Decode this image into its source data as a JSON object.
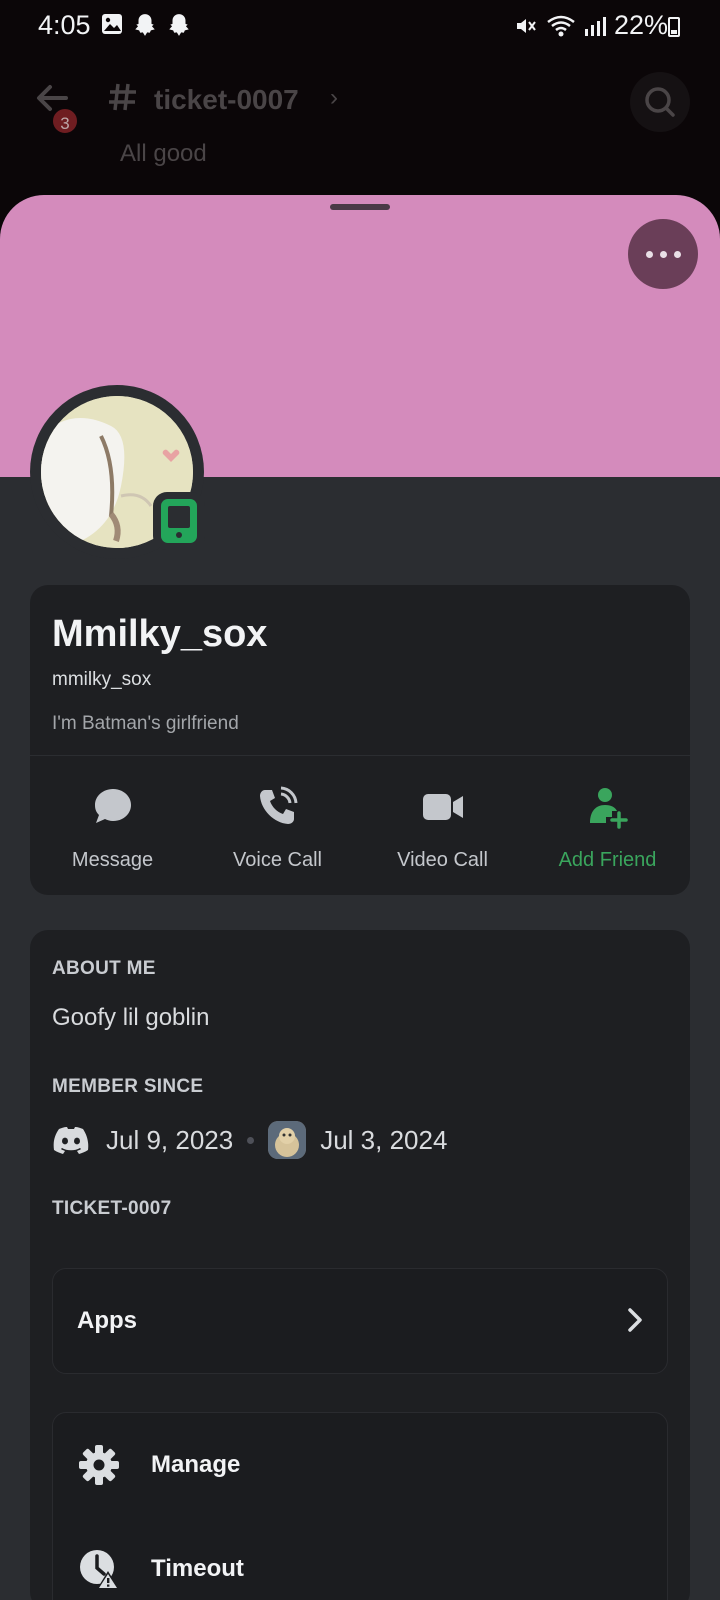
{
  "status_bar": {
    "time": "4:05",
    "battery": "22%",
    "left_icons": [
      "gallery-icon",
      "snapchat-icon",
      "snapchat-icon"
    ],
    "right_icons": [
      "mute-icon",
      "wifi-icon",
      "signal-icon",
      "battery-icon"
    ]
  },
  "channel_header": {
    "title": "ticket-0007",
    "unread_badge": "3",
    "peek_message": "All good"
  },
  "profile": {
    "banner_color": "#d48bbc",
    "display_name": "Mmilky_sox",
    "username": "mmilky_sox",
    "pronouns": "I'm Batman's girlfriend",
    "status": "mobile-online",
    "status_color": "#23a55a",
    "actions": [
      {
        "label": "Message",
        "icon": "message-icon"
      },
      {
        "label": "Voice Call",
        "icon": "voice-call-icon"
      },
      {
        "label": "Video Call",
        "icon": "video-call-icon"
      },
      {
        "label": "Add Friend",
        "icon": "add-friend-icon"
      }
    ]
  },
  "about": {
    "heading": "ABOUT ME",
    "text": "Goofy lil goblin"
  },
  "member_since": {
    "heading": "MEMBER SINCE",
    "discord_date": "Jul 9, 2023",
    "server_date": "Jul 3, 2024"
  },
  "server_section": {
    "heading": "TICKET-0007",
    "apps_label": "Apps",
    "manage_label": "Manage",
    "timeout_label": "Timeout"
  }
}
